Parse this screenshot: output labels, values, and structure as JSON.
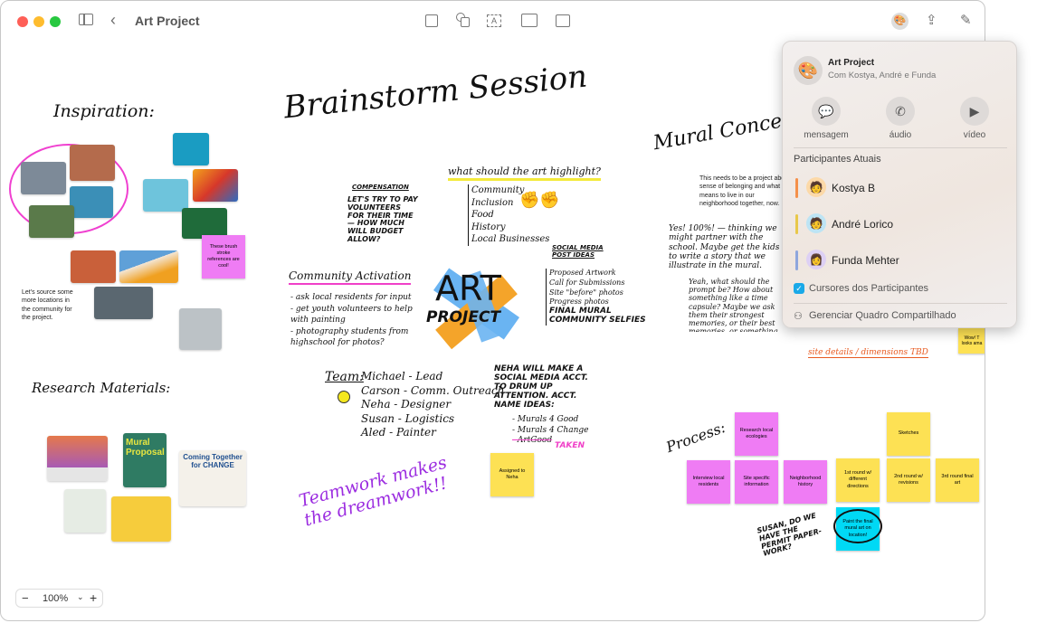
{
  "window": {
    "title": "Art Project",
    "colors": {
      "close": "#fe5f57",
      "minimize": "#febc2e",
      "zoom": "#28c840"
    }
  },
  "toolbar": {
    "icons": [
      "sidebar-icon",
      "back-icon",
      "note-icon",
      "shapes-icon",
      "text-box-icon",
      "media-icon",
      "file-icon",
      "collaboration-icon",
      "share-icon",
      "compose-icon"
    ]
  },
  "board": {
    "inspiration_title": "Inspiration:",
    "brainstorm_title": "Brainstorm Session",
    "mural_title": "Mural Concepts",
    "research_title": "Research Materials:",
    "process_title": "Process:",
    "brush_note": "These brush stroke references are cool!",
    "locations_text": "Let's source some more locations in the community for the project.",
    "compensation": {
      "title": "Compensation",
      "body": "Let's try to pay volunteers for their time — how much will budget allow?"
    },
    "highlight": {
      "title": "what should the art highlight?",
      "items": [
        "Community",
        "Inclusion",
        "Food",
        "History",
        "Local Businesses"
      ]
    },
    "social": {
      "title": "Social Media Post Ideas",
      "items": [
        "Proposed Artwork",
        "Call for Submissions",
        "Site \"before\" photos",
        "Progress photos",
        "Final Mural",
        "Community Selfies"
      ]
    },
    "art_logo": [
      "ART",
      "PROJECT"
    ],
    "activation": {
      "title": "Community Activation",
      "items": [
        "- ask local residents for input",
        "- get youth volunteers to help with painting",
        "- photography students from highschool for photos?"
      ]
    },
    "team": {
      "label": "Team:",
      "members": [
        "Michael - Lead",
        "Carson - Comm. Outreach",
        "Neha - Designer",
        "Susan - Logistics",
        "Aled - Painter"
      ]
    },
    "neha": {
      "body": "Neha will make a social media acct. to drum up attention. Acct. name ideas:",
      "ideas": [
        "- Murals 4 Good",
        "- Murals 4 Change",
        "- ArtGood"
      ],
      "taken": "Taken"
    },
    "assigned_note": "Assigned to Neha",
    "teamwork": "Teamwork makes the dreamwork!!",
    "mural_text": "This needs to be a project about sense of belonging and what it means to live in our neighborhood together, now.",
    "yes_note": "Yes! 100%! — thinking we might partner with the school. Maybe get the kids to write a story that we illustrate in the mural.",
    "yeah_note": "Yeah, what should the prompt be? How about something like a time capsule? Maybe we ask them their strongest memories, or their best memories, or something like what \"home\" means to them?",
    "site_details": "site details / dimensions TBD",
    "wow_note": "Wow! T looks ama",
    "research_cards": [
      {
        "title": "Mural Proposal",
        "caption": "Mural Proposal"
      },
      {
        "title": "Coming Together for CHANGE",
        "caption": "Coming Together for Change"
      }
    ],
    "process_notes": {
      "research": "Research local ecologies",
      "interview": "Interview local residents",
      "site": "Site specific information",
      "neighborhood": "Neighborhood history",
      "sketches": "Sketches",
      "round1": "1st round w/ different directions",
      "round2": "2nd round w/ revisions",
      "round3": "3rd round final art",
      "paint": "Paint the final mural art on location!"
    },
    "susan_note": "Susan, do we have the permit paper-work?"
  },
  "popover": {
    "title": "Art Project",
    "subtitle": "Com Kostya, André e Funda",
    "actions": [
      {
        "label": "mensagem",
        "icon": "message-icon"
      },
      {
        "label": "áudio",
        "icon": "phone-icon"
      },
      {
        "label": "vídeo",
        "icon": "video-icon"
      }
    ],
    "section": "Participantes Atuais",
    "participants": [
      {
        "name": "Kostya B",
        "color": "#f5904a"
      },
      {
        "name": "André Lorico",
        "color": "#e8c84a"
      },
      {
        "name": "Funda Mehter",
        "color": "#8ea6dd"
      }
    ],
    "cursors_label": "Cursores dos Participantes",
    "cursors_checked": true,
    "manage_label": "Gerenciar Quadro Compartilhado"
  },
  "zoom": {
    "value": "100%",
    "minus": "−",
    "plus": "+"
  }
}
